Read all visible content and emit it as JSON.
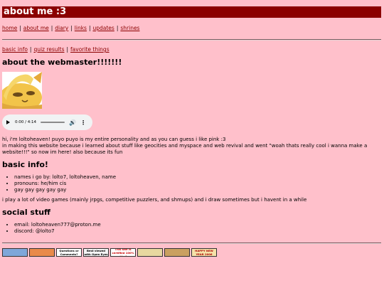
{
  "header": {
    "title": "about me :3"
  },
  "nav": [
    {
      "label": "home"
    },
    {
      "label": "about me"
    },
    {
      "label": "diary"
    },
    {
      "label": "links"
    },
    {
      "label": "updates"
    },
    {
      "label": "shrines"
    }
  ],
  "subnav": [
    {
      "label": "basic info"
    },
    {
      "label": "quiz results"
    },
    {
      "label": "favorite things"
    }
  ],
  "webmaster": {
    "heading": "about the webmaster!!!!!!!",
    "intro_line1": "hi, i'm loltoheaven! puyo puyo is my entire personality and as you can guess i like pink :3",
    "intro_line2": "in making this website because i learned about stuff like geocities and myspace and web revival and went \"woah thats really cool i wanna make a website!!!\" so now im here! also because its fun"
  },
  "audio": {
    "time": "0:00 / 4:14"
  },
  "basic_info": {
    "heading": "basic info!",
    "items": [
      "names i go by: lolto7, loltoheaven, name",
      "pronouns: he/him cis",
      "gay gay gay gay gay"
    ],
    "gaming": "i play a lot of video games (mainly jrpgs, competitive puzzlers, and shmups) and i draw sometimes but i havent in a while"
  },
  "social": {
    "heading": "social stuff",
    "items": [
      "email: loltoheaven777@proton.me",
      "discord: @lolto7"
    ]
  },
  "badges": [
    {
      "text": "",
      "bg": "#7fa7d9",
      "fg": "#ffffff"
    },
    {
      "text": "",
      "bg": "#e98a4a",
      "fg": "#ffffff"
    },
    {
      "text": "Questions or Comments?",
      "bg": "#ffffff",
      "fg": "#000000"
    },
    {
      "text": "Best viewed with Open Eyes",
      "bg": "#f4f4f4",
      "fg": "#000000"
    },
    {
      "text": "This site is certified 100% cookie free",
      "bg": "#ffffff",
      "fg": "#cc0000"
    },
    {
      "text": "",
      "bg": "#e8d8a0",
      "fg": "#000000"
    },
    {
      "text": "",
      "bg": "#caa060",
      "fg": "#000000"
    },
    {
      "text": "HAPPY NEW YEAR 2006",
      "bg": "#f6e2a8",
      "fg": "#aa0000"
    }
  ]
}
